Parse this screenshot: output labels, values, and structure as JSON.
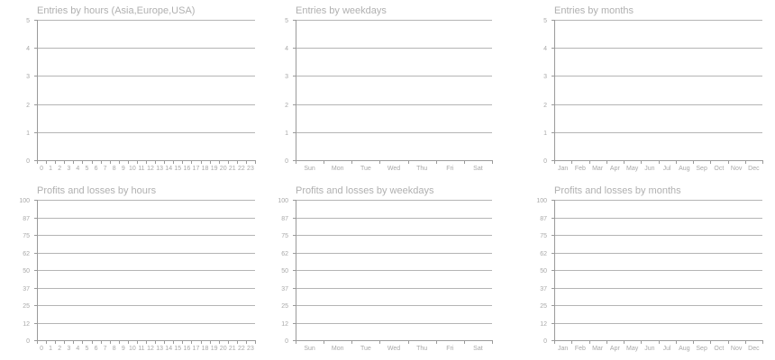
{
  "chart_data": [
    {
      "type": "bar",
      "title": "Entries by hours (Asia,Europe,USA)",
      "xlabel": "",
      "ylabel": "",
      "categories": [
        "0",
        "1",
        "2",
        "3",
        "4",
        "5",
        "6",
        "7",
        "8",
        "9",
        "10",
        "11",
        "12",
        "13",
        "14",
        "15",
        "16",
        "17",
        "18",
        "19",
        "20",
        "21",
        "22",
        "23"
      ],
      "ylim": [
        0,
        5
      ],
      "yticks": [
        "0",
        "1",
        "2",
        "3",
        "4",
        "5"
      ],
      "values": [
        0,
        0,
        0,
        0,
        0,
        0,
        0,
        0,
        0,
        0,
        0,
        0,
        0,
        0,
        0,
        0,
        0,
        0,
        0,
        0,
        0,
        0,
        0,
        0
      ],
      "grid": true
    },
    {
      "type": "bar",
      "title": "Entries by weekdays",
      "xlabel": "",
      "ylabel": "",
      "categories": [
        "Sun",
        "Mon",
        "Tue",
        "Wed",
        "Thu",
        "Fri",
        "Sat"
      ],
      "ylim": [
        0,
        5
      ],
      "yticks": [
        "0",
        "1",
        "2",
        "3",
        "4",
        "5"
      ],
      "values": [
        0,
        0,
        0,
        0,
        0,
        0,
        0
      ],
      "grid": true
    },
    {
      "type": "bar",
      "title": "Entries by months",
      "xlabel": "",
      "ylabel": "",
      "categories": [
        "Jan",
        "Feb",
        "Mar",
        "Apr",
        "May",
        "Jun",
        "Jul",
        "Aug",
        "Sep",
        "Oct",
        "Nov",
        "Dec"
      ],
      "ylim": [
        0,
        5
      ],
      "yticks": [
        "0",
        "1",
        "2",
        "3",
        "4",
        "5"
      ],
      "values": [
        0,
        0,
        0,
        0,
        0,
        0,
        0,
        0,
        0,
        0,
        0,
        0
      ],
      "grid": true
    },
    {
      "type": "bar",
      "title": "Profits and losses by hours",
      "xlabel": "",
      "ylabel": "",
      "categories": [
        "0",
        "1",
        "2",
        "3",
        "4",
        "5",
        "6",
        "7",
        "8",
        "9",
        "10",
        "11",
        "12",
        "13",
        "14",
        "15",
        "16",
        "17",
        "18",
        "19",
        "20",
        "21",
        "22",
        "23"
      ],
      "ylim": [
        0,
        100
      ],
      "yticks": [
        "0",
        "12",
        "25",
        "37",
        "50",
        "62",
        "75",
        "87",
        "100"
      ],
      "values": [
        0,
        0,
        0,
        0,
        0,
        0,
        0,
        0,
        0,
        0,
        0,
        0,
        0,
        0,
        0,
        0,
        0,
        0,
        0,
        0,
        0,
        0,
        0,
        0
      ],
      "grid": true
    },
    {
      "type": "bar",
      "title": "Profits and losses by weekdays",
      "xlabel": "",
      "ylabel": "",
      "categories": [
        "Sun",
        "Mon",
        "Tue",
        "Wed",
        "Thu",
        "Fri",
        "Sat"
      ],
      "ylim": [
        0,
        100
      ],
      "yticks": [
        "0",
        "12",
        "25",
        "37",
        "50",
        "62",
        "75",
        "87",
        "100"
      ],
      "values": [
        0,
        0,
        0,
        0,
        0,
        0,
        0
      ],
      "grid": true
    },
    {
      "type": "bar",
      "title": "Profits and losses by months",
      "xlabel": "",
      "ylabel": "",
      "categories": [
        "Jan",
        "Feb",
        "Mar",
        "Apr",
        "May",
        "Jun",
        "Jul",
        "Aug",
        "Sep",
        "Oct",
        "Nov",
        "Dec"
      ],
      "ylim": [
        0,
        100
      ],
      "yticks": [
        "0",
        "12",
        "25",
        "37",
        "50",
        "62",
        "75",
        "87",
        "100"
      ],
      "values": [
        0,
        0,
        0,
        0,
        0,
        0,
        0,
        0,
        0,
        0,
        0,
        0
      ],
      "grid": true
    }
  ],
  "colors": {
    "title": "#b0b0b0",
    "tick_label": "#a8a8a8",
    "grid": "#b4b4b4",
    "axis": "#9a9a9a",
    "background": "#ffffff"
  }
}
